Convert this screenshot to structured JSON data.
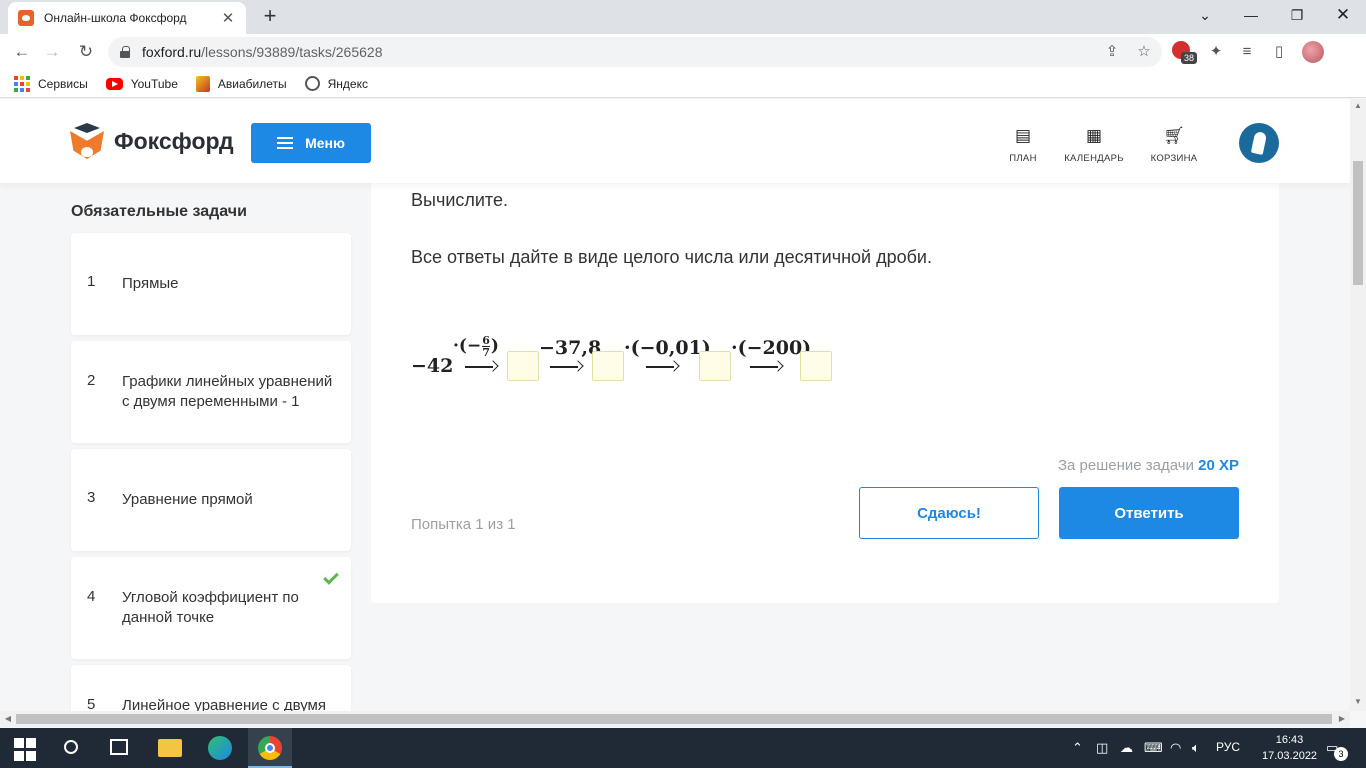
{
  "browser": {
    "tab_title": "Онлайн-школа Фоксфорд",
    "url_host": "foxford.ru",
    "url_path": "/lessons/93889/tasks/265628",
    "extension_badge": "38",
    "bookmarks": [
      {
        "label": "Сервисы",
        "icon": "apps-grid-icon"
      },
      {
        "label": "YouTube",
        "icon": "youtube-icon"
      },
      {
        "label": "Авиабилеты",
        "icon": "aviabilety-icon"
      },
      {
        "label": "Яндекс",
        "icon": "globe-icon"
      }
    ]
  },
  "header": {
    "logo_text": "Фоксфорд",
    "menu_label": "Меню",
    "nav": [
      {
        "label": "ПЛАН",
        "icon": "plan-icon"
      },
      {
        "label": "КАЛЕНДАРЬ",
        "icon": "calendar-icon"
      },
      {
        "label": "КОРЗИНА",
        "icon": "cart-icon"
      }
    ]
  },
  "sidebar": {
    "title": "Обязательные задачи",
    "tasks": [
      {
        "num": "1",
        "label": "Прямые",
        "done": false
      },
      {
        "num": "2",
        "label": "Графики линейных уравнений с двумя переменными - 1",
        "done": false
      },
      {
        "num": "3",
        "label": "Уравнение прямой",
        "done": false
      },
      {
        "num": "4",
        "label": "Угловой коэффициент по данной точке",
        "done": true
      },
      {
        "num": "5",
        "label": "Линейное уравнение с двумя",
        "done": false
      }
    ]
  },
  "task": {
    "prompt": "Вычислите.",
    "instruction": "Все ответы дайте в виде целого числа или десятичной дроби.",
    "math": {
      "start": "−42",
      "op1": "·(−",
      "op1_num": "6",
      "op1_den": "7",
      "op1_close": ")",
      "op2": "−37,8",
      "op3": "·(−0,01)",
      "op4": "·(−200)"
    },
    "xp_label": "За решение задачи",
    "xp_value": "20 XP",
    "attempt": "Попытка 1 из 1",
    "giveup_label": "Сдаюсь!",
    "answer_label": "Ответить"
  },
  "taskbar": {
    "lang": "РУС",
    "time": "16:43",
    "date": "17.03.2022",
    "notifications": "3"
  },
  "colors": {
    "accent": "#1e88e5",
    "success": "#5bb84d",
    "answer_box": "#fffce8"
  }
}
